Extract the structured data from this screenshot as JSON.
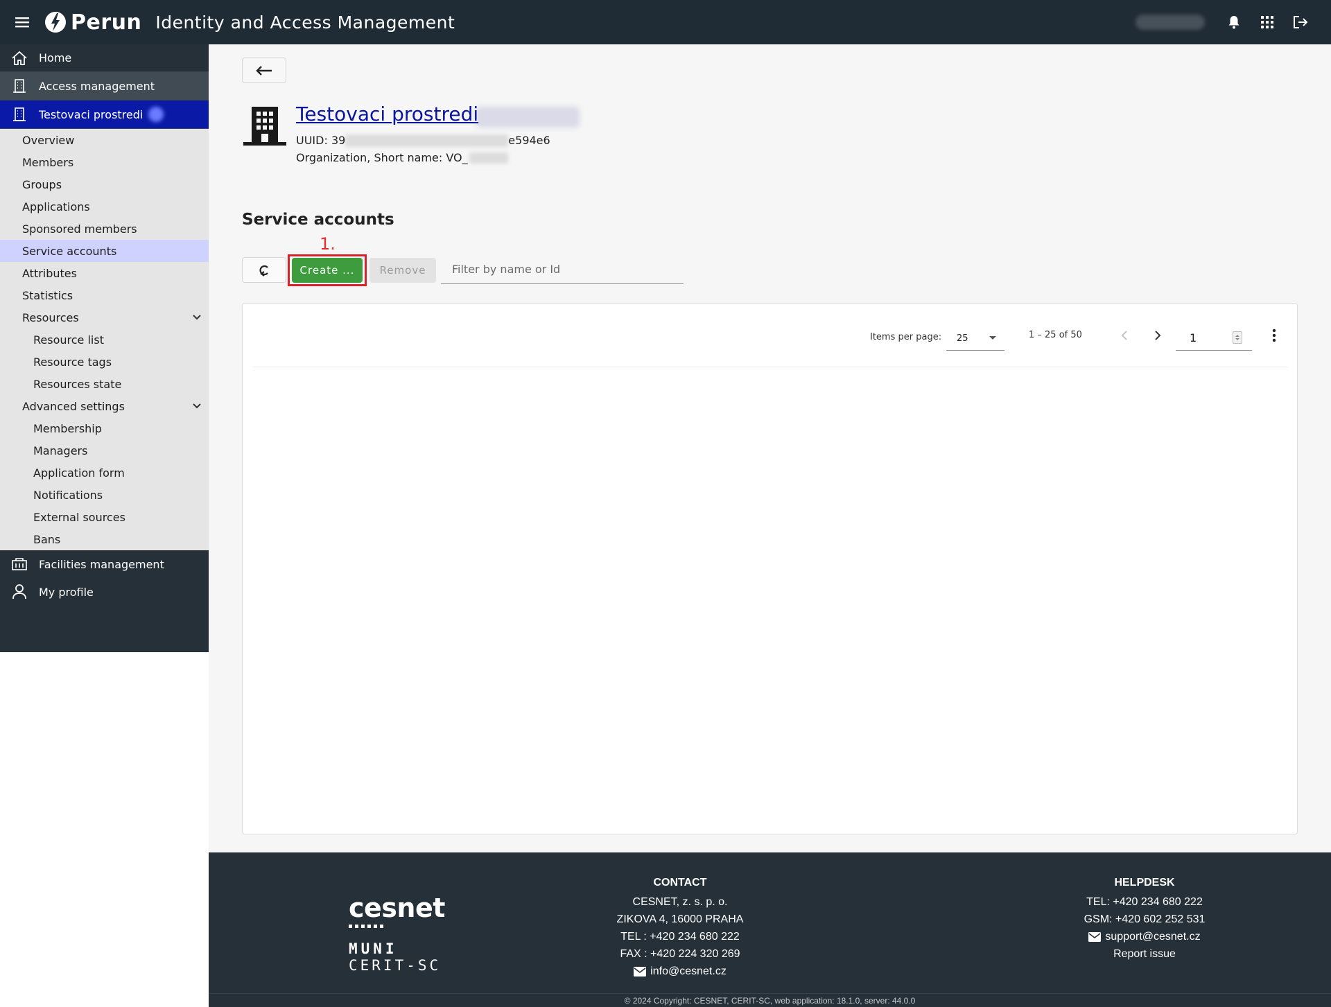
{
  "header": {
    "logo_text": "Perun",
    "app_title": "Identity and Access Management"
  },
  "sidebar": {
    "home": "Home",
    "access_management": "Access management",
    "vo_name": "Testovaci prostredi",
    "sub_items": [
      "Overview",
      "Members",
      "Groups",
      "Applications",
      "Sponsored members",
      "Service accounts",
      "Attributes",
      "Statistics"
    ],
    "resources": "Resources",
    "resources_items": [
      "Resource list",
      "Resource tags",
      "Resources state"
    ],
    "advanced_settings": "Advanced settings",
    "advanced_items": [
      "Membership",
      "Managers",
      "Application form",
      "Notifications",
      "External sources",
      "Bans"
    ],
    "facilities": "Facilities management",
    "my_profile": "My profile"
  },
  "entity": {
    "name": "Testovaci prostredi",
    "uuid_prefix": "UUID: 39",
    "uuid_suffix": "e594e6",
    "org_line": "Organization, Short name: VO_"
  },
  "section": {
    "title": "Service accounts",
    "step_label": "1.",
    "create_label": "Create ...",
    "remove_label": "Remove",
    "filter_placeholder": "Filter by name or Id"
  },
  "pager": {
    "items_per_page_label": "Items per page:",
    "page_size": "25",
    "range": "1 – 25 of 50",
    "page": "1"
  },
  "footer": {
    "cesnet": "cesnet",
    "muni": "MUNI",
    "cerit": "CERIT-SC",
    "contact_title": "CONTACT",
    "contact_lines": [
      "CESNET, z. s. p. o.",
      "ZIKOVA 4, 16000 PRAHA",
      "TEL : +420 234 680 222",
      "FAX : +420 224 320 269"
    ],
    "contact_email": "info@cesnet.cz",
    "help_title": "HELPDESK",
    "help_lines": [
      "TEL: +420 234 680 222",
      "GSM: +420 602 252 531"
    ],
    "help_email": "support@cesnet.cz",
    "report": "Report issue",
    "copyright": "© 2024 Copyright: CESNET, CERIT-SC, web application: 18.1.0, server: 44.0.0"
  },
  "colors": {
    "topbar": "#1f2b35",
    "sidebar": "#253038",
    "vo_highlight": "#0b1aa6",
    "active_item": "#cfd1ff",
    "create_button": "#3e9b3e",
    "annotation_red": "#d8222a"
  }
}
